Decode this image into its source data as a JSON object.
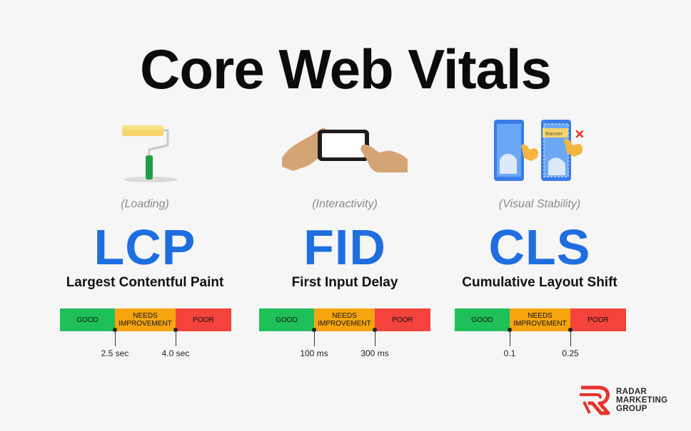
{
  "title": "Core Web Vitals",
  "metrics": [
    {
      "category": "(Loading)",
      "abbr": "LCP",
      "name": "Largest Contentful Paint",
      "icon": "paint-roller-icon",
      "segments": [
        "GOOD",
        "NEEDS\nIMPROVEMENT",
        "POOR"
      ],
      "thresholds": [
        "2.5 sec",
        "4.0 sec"
      ]
    },
    {
      "category": "(Interactivity)",
      "abbr": "FID",
      "name": "First Input Delay",
      "icon": "hand-tapping-phone-icon",
      "segments": [
        "GOOD",
        "NEEDS\nIMPROVEMENT",
        "POOR"
      ],
      "thresholds": [
        "100 ms",
        "300 ms"
      ]
    },
    {
      "category": "(Visual Stability)",
      "abbr": "CLS",
      "name": "Cumulative Layout Shift",
      "icon": "layout-shift-phones-icon",
      "banner_text": "Banner",
      "segments": [
        "GOOD",
        "NEEDS\nIMPROVEMENT",
        "POOR"
      ],
      "thresholds": [
        "0.1",
        "0.25"
      ]
    }
  ],
  "logo": {
    "line1": "RADAR",
    "line2": "MARKETING",
    "line3": "GROUP"
  },
  "colors": {
    "accent_blue": "#1f6ee0",
    "good": "#1fc05a",
    "needs_improvement": "#f6a50f",
    "poor": "#f4433c",
    "logo_red": "#e8332b"
  }
}
